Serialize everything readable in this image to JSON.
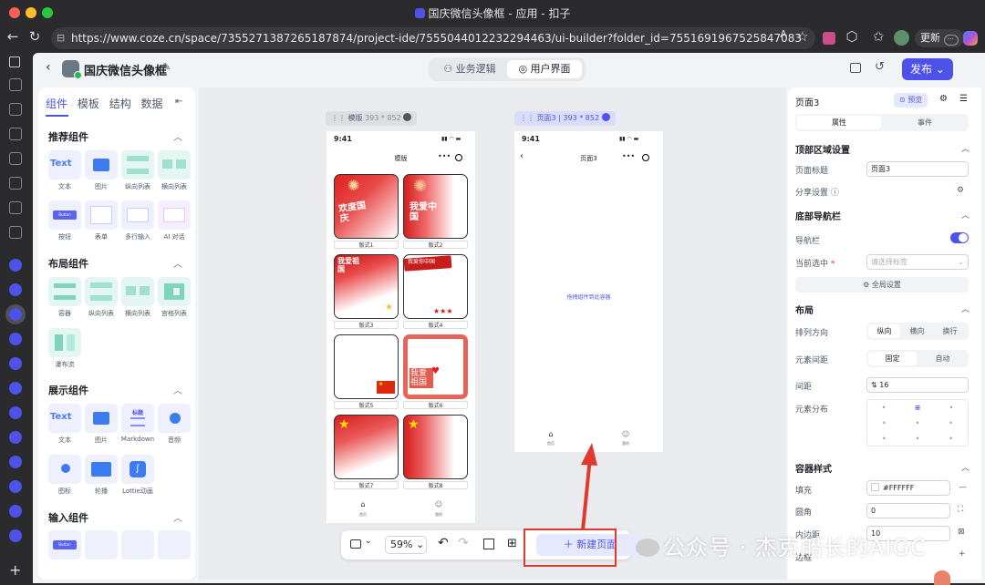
{
  "browser": {
    "window_title": "国庆微信头像框 - 应用 - 扣子",
    "url": "https://www.coze.cn/space/7355271387265187874/project-ide/7555044012232294463/ui-builder?folder_id=7551691967525847083",
    "update_label": "更新",
    "colors": {
      "close": "#fe5f57",
      "min": "#febc2e",
      "max": "#28c840"
    }
  },
  "app": {
    "project_title": "国庆微信头像框",
    "tabs": [
      {
        "label": "业务逻辑",
        "active": false
      },
      {
        "label": "用户界面",
        "active": true
      }
    ],
    "publish_label": "发布",
    "accent": "#4d53e8"
  },
  "components": {
    "tabs": [
      {
        "label": "组件",
        "active": true
      },
      {
        "label": "模板",
        "active": false
      },
      {
        "label": "结构",
        "active": false
      },
      {
        "label": "数据",
        "active": false
      }
    ],
    "sections": [
      {
        "title": "推荐组件",
        "items": [
          "文本",
          "图片",
          "纵向列表",
          "横向列表",
          "按钮",
          "表单",
          "多行输入",
          "AI 对话"
        ]
      },
      {
        "title": "布局组件",
        "items": [
          "容器",
          "纵向列表",
          "横向列表",
          "宫格列表",
          "瀑布流"
        ]
      },
      {
        "title": "展示组件",
        "items": [
          "文本",
          "图片",
          "Markdown",
          "音频",
          "图标",
          "轮播",
          "Lottie动画"
        ]
      },
      {
        "title": "输入组件",
        "items": []
      }
    ],
    "thumb": {
      "text": "Text",
      "button": "Button",
      "markdown": "标题"
    }
  },
  "canvas": {
    "frame1": {
      "label": "模版",
      "size": "393 * 852",
      "time": "9:41",
      "page_title": "模版",
      "cards": [
        "版式1",
        "版式2",
        "版式3",
        "版式4",
        "版式5",
        "版式6",
        "版式7",
        "版式8"
      ],
      "tabbar": [
        "首页",
        "我的"
      ]
    },
    "frame2": {
      "label": "页面3 | 393 * 852",
      "time": "9:41",
      "page_title": "页面3",
      "drop_hint": "拖拽组件到此容器",
      "tabbar": [
        "首页",
        "我的"
      ]
    },
    "card_text": {
      "c1": "欢度国庆",
      "c2": "我爱中国",
      "c3": "我爱祖国",
      "c4": "我爱你中国",
      "c6": "我爱祖国"
    }
  },
  "toolbar": {
    "zoom": "59%",
    "new_page": "新建页面"
  },
  "properties": {
    "page_name": "页面3",
    "preview": "预览",
    "tabs": [
      {
        "label": "属性",
        "active": true
      },
      {
        "label": "事件",
        "active": false
      }
    ],
    "top_section": "顶部区域设置",
    "page_title_label": "页面标题",
    "page_title_value": "页面3",
    "share_label": "分享设置",
    "bottom_nav_section": "底部导航栏",
    "nav_label": "导航栏",
    "nav_enabled": true,
    "selected_label": "当前选中",
    "selected_placeholder": "请选择标签",
    "global_settings": "全局设置",
    "layout_section": "布局",
    "direction_label": "排列方向",
    "direction_options": [
      {
        "label": "纵向",
        "active": true
      },
      {
        "label": "横向",
        "active": false
      },
      {
        "label": "换行",
        "active": false
      }
    ],
    "spacing_label": "元素间距",
    "spacing_options": [
      {
        "label": "固定",
        "active": true
      },
      {
        "label": "自动",
        "active": false
      }
    ],
    "gap_label": "间距",
    "gap_value": "16",
    "distribution_label": "元素分布",
    "container_section": "容器样式",
    "fill_label": "填充",
    "fill_value": "#FFFFFF",
    "radius_label": "圆角",
    "radius_value": "0",
    "padding_label": "内边距",
    "padding_value": "10",
    "border_label": "边框"
  },
  "watermark": "公众号 · 杰克船长的AIGC"
}
